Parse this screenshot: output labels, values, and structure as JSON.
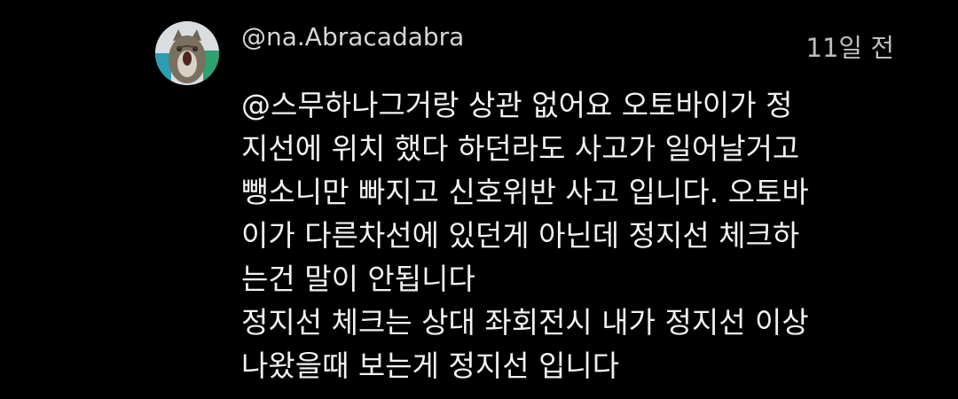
{
  "comment": {
    "author": "@na.Abracadabra",
    "timestamp": "11일 전",
    "avatar_icon": "cat-avatar-icon",
    "body_lines": [
      "@스무하나그거랑 상관 없어요 오토바이가 정",
      "지선에 위치 했다 하던라도 사고가 일어날거고",
      "뺑소니만 빠지고 신호위반 사고 입니다. 오토바",
      "이가 다른차선에 있던게 아닌데 정지선 체크하",
      "는건 말이 안됩니다",
      "정지선 체크는 상대 좌회전시 내가 정지선 이상",
      "나왔을때 보는게 정지선 입니다"
    ]
  },
  "colors": {
    "background": "#000000",
    "author_text": "#d6d6d6",
    "timestamp_text": "#bdbdbd",
    "body_text": "#f2f2f2"
  }
}
